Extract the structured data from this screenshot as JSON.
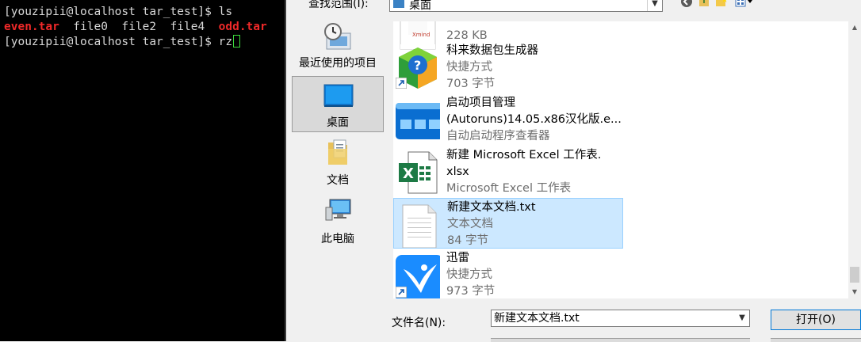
{
  "terminal": {
    "line1_prompt": "[youzipii@localhost tar_test]$ ",
    "line1_cmd": "ls",
    "line2": [
      {
        "text": "even.tar",
        "red": true
      },
      {
        "text": "  file0  file2  file4  ",
        "red": false
      },
      {
        "text": "odd.tar",
        "red": true
      }
    ],
    "line3_prompt": "[youzipii@localhost tar_test]$ ",
    "line3_cmd": "rz"
  },
  "dialog": {
    "lookin_label": "查找范围(I):",
    "lookin_value": "桌面",
    "places": [
      {
        "label": "最近使用的项目",
        "icon": "recent-items-icon"
      },
      {
        "label": "桌面",
        "icon": "desktop-icon",
        "selected": true
      },
      {
        "label": "文档",
        "icon": "documents-icon"
      },
      {
        "label": "此电脑",
        "icon": "this-pc-icon"
      }
    ],
    "items": [
      {
        "name1": "",
        "name2": "",
        "sub1": "228 KB",
        "sub2": "",
        "icon": "xmind-icon",
        "selected": false
      },
      {
        "name1": "科来数据包生成器",
        "name2": "",
        "sub1": "快捷方式",
        "sub2": "703 字节",
        "icon": "packet-builder-icon",
        "shortcut": true
      },
      {
        "name1": "启动项目管理",
        "name2": "(Autoruns)14.05.x86汉化版.e...",
        "sub1": "自动启动程序查看器",
        "sub2": "",
        "icon": "autoruns-icon"
      },
      {
        "name1": "新建 Microsoft Excel 工作表.",
        "name2": "xlsx",
        "sub1": "Microsoft Excel 工作表",
        "sub2": "",
        "icon": "excel-icon"
      },
      {
        "name1": "新建文本文档.txt",
        "name2": "",
        "sub1": "文本文档",
        "sub2": "84 字节",
        "icon": "text-file-icon",
        "selected": true
      },
      {
        "name1": "迅雷",
        "name2": "",
        "sub1": "快捷方式",
        "sub2": "973 字节",
        "icon": "xunlei-icon",
        "shortcut": true
      }
    ],
    "xmind_label": "Xmind",
    "filename_label": "文件名(N):",
    "filename_value": "新建文本文档.txt",
    "open_button": "打开(O)"
  }
}
